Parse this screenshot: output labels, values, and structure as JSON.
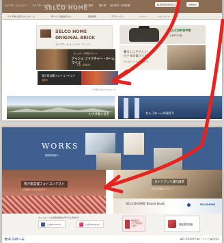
{
  "top_page": {
    "watermark": "SELCO HOME",
    "nav": [
      "セルコホームについて",
      "セルコホームの家",
      "住宅ラインナップ",
      "施工実例",
      "展示場",
      "会社案内・採用情報"
    ],
    "buttons": [
      "● 資料請求お申込み",
      "お問合せ"
    ],
    "subnav": [
      "カナダ輸入住宅 セルコホーム",
      "家づくりを始める方へ",
      "建築実例",
      "モデルハウス",
      "イベント",
      "ショールーム"
    ],
    "brick": {
      "title1": "SELCO HOME",
      "title2": "ORIGINAL BRICK",
      "sub": "セルコホーム オリジナル ブリック"
    },
    "handcraft": {
      "title": "SELCOHOME",
      "sub": "×手作りの家"
    },
    "fukuro": {
      "small": "セルコホーム特別ブランド",
      "title": "アッシェ ファクチャー・ホームライフ",
      "brand": "Ch. ateau"
    },
    "kurashi": {
      "line1": "暮らしにやさしい",
      "line2": "カナダの家づくり",
      "note": "セルコホーム ライフスタイル"
    },
    "photo_contest": {
      "title": "我が家自慢フォトコンテスト",
      "status": "開催中!"
    },
    "tiny_caption": "カナダ輸入住宅のセルコホーム",
    "models": {
      "label": "カナダ輸入住宅"
    },
    "series": {
      "label": "セルコホームの家作り"
    }
  },
  "bottom_page": {
    "works": {
      "title": "WORKS",
      "sub": "建築実例紹介"
    },
    "contest": {
      "title": "我が家自慢フォトコンテスト",
      "sub": "ご応募はこちらからどうぞ"
    },
    "guide": {
      "title": "ガイドブック資料請求",
      "sub": "カタログ無料プレゼント"
    },
    "brand_book": {
      "title": "SELCOHOME Brand Book",
      "logo": "SELCOHOME"
    },
    "sns": {
      "intro": "セルコホームの最新情報はSNSでも配信中!",
      "facebook": "公式Facebook",
      "instagram": "公式Instagram"
    },
    "side_banner": {
      "line1": "株式会社",
      "line2": "カナダ住宅の",
      "line3": "ご紹介"
    },
    "badge": {
      "label": "保証認定制度"
    },
    "footer": {
      "logo": "セルコホーム",
      "links": "●個人情報保護方針  ●サイトマップ  ●情報採集"
    }
  },
  "colors": {
    "brown_bar": "#8a6d54",
    "works_blue": "#3f5f91",
    "arrow_red": "#e8231e"
  }
}
